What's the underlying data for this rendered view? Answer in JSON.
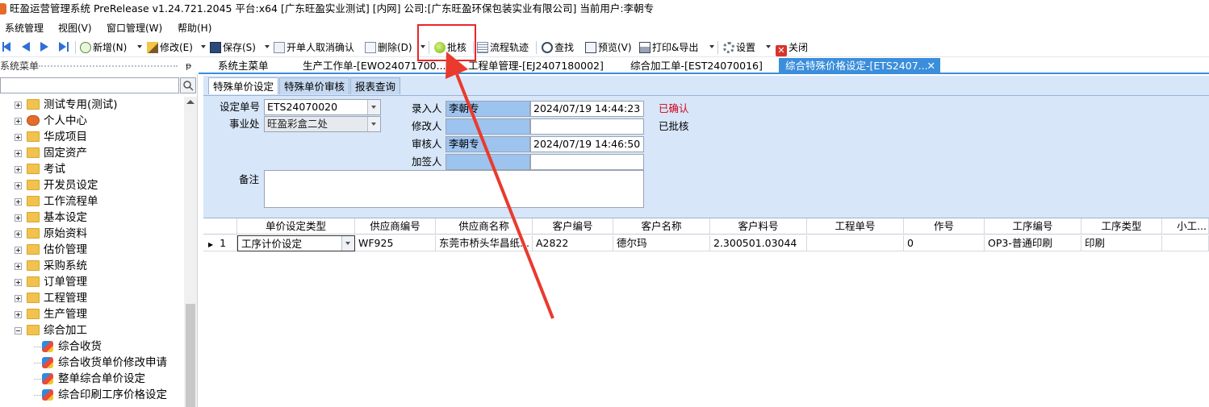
{
  "window": {
    "title": "旺盈运营管理系统 PreRelease v1.24.721.2045 平台:x64  [广东旺盈实业测试] [内网] 公司:[广东旺盈环保包装实业有限公司] 当前用户:李朝专"
  },
  "menu": [
    "系统管理",
    "视图(V)",
    "窗口管理(W)",
    "帮助(H)"
  ],
  "toolbar": {
    "new": "新增(N)",
    "edit": "修改(E)",
    "save": "保存(S)",
    "cancel_confirm": "开单人取消确认",
    "delete": "删除(D)",
    "approve": "批核",
    "flow": "流程轨迹",
    "find": "查找",
    "preview": "预览(V)",
    "print_export": "打印&导出",
    "settings": "设置",
    "close": "关闭"
  },
  "left_panel": {
    "title": "系统菜单",
    "tree": [
      {
        "label": "测试专用(测试)",
        "type": "folder"
      },
      {
        "label": "个人中心",
        "type": "person"
      },
      {
        "label": "华成项目",
        "type": "folder"
      },
      {
        "label": "固定资产",
        "type": "folder"
      },
      {
        "label": "考试",
        "type": "folder"
      },
      {
        "label": "开发员设定",
        "type": "folder"
      },
      {
        "label": "工作流程单",
        "type": "folder"
      },
      {
        "label": "基本设定",
        "type": "folder"
      },
      {
        "label": "原始资料",
        "type": "folder"
      },
      {
        "label": "估价管理",
        "type": "folder"
      },
      {
        "label": "采购系统",
        "type": "folder"
      },
      {
        "label": "订单管理",
        "type": "folder"
      },
      {
        "label": "工程管理",
        "type": "folder"
      },
      {
        "label": "生产管理",
        "type": "folder"
      },
      {
        "label": "综合加工",
        "type": "folder-open"
      },
      {
        "label": "综合收货",
        "type": "leaf"
      },
      {
        "label": "综合收货单价修改申请",
        "type": "leaf"
      },
      {
        "label": "整单综合单价设定",
        "type": "leaf"
      },
      {
        "label": "综合印刷工序价格设定",
        "type": "leaf"
      }
    ]
  },
  "doc_tabs": [
    {
      "label": "系统主菜单"
    },
    {
      "label": "生产工作单-[EWO24071700..."
    },
    {
      "label": "工程单管理-[EJ2407180002]"
    },
    {
      "label": "综合加工单-[EST24070016]"
    },
    {
      "label": "综合特殊价格设定-[ETS2407..."
    }
  ],
  "sub_tabs": [
    "特殊单价设定",
    "特殊单价审核",
    "报表查询"
  ],
  "form": {
    "doc_no_label": "设定单号",
    "doc_no": "ETS24070020",
    "division_label": "事业处",
    "division": "旺盈彩盒二处",
    "entry_label": "录入人",
    "entry_user": "李朝专",
    "entry_time": "2024/07/19 14:44:23",
    "modify_label": "修改人",
    "modify_user": "",
    "modify_time": "",
    "review_label": "审核人",
    "review_user": "李朝专",
    "review_time": "2024/07/19 14:46:50",
    "cosign_label": "加签人",
    "cosign_user": "",
    "cosign_time": "",
    "status_confirmed": "已确认",
    "status_approved": "已批核",
    "status_confirmed_color": "#d0021b",
    "remark_label": "备注",
    "remark": ""
  },
  "grid": {
    "columns": [
      "单价设定类型",
      "供应商编号",
      "供应商名称",
      "客户编号",
      "客户名称",
      "客户料号",
      "工程单号",
      "作号",
      "工序编号",
      "工序类型",
      "小工..."
    ],
    "rows": [
      {
        "index": "1",
        "cells": [
          "工序计价设定",
          "WF925",
          "东莞市桥头华昌纸...",
          "A2822",
          "德尔玛",
          "2.300501.03044",
          "",
          "0",
          "OP3-普通印刷",
          "印刷",
          ""
        ]
      }
    ]
  }
}
